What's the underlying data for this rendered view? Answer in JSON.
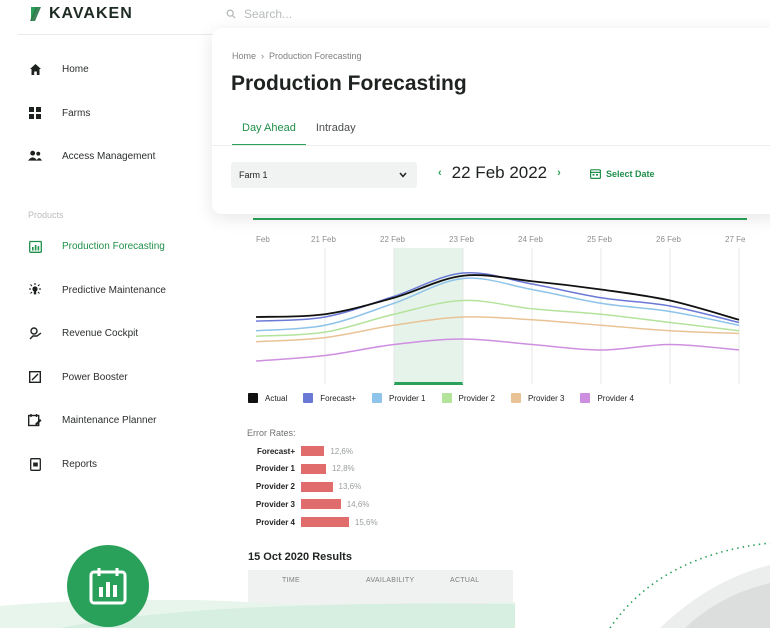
{
  "app": {
    "brand": "KAVAKEN"
  },
  "search": {
    "placeholder": "Search..."
  },
  "sidebar": {
    "items": [
      {
        "label": "Home",
        "icon": "home-icon"
      },
      {
        "label": "Farms",
        "icon": "grid-icon"
      },
      {
        "label": "Access Management",
        "icon": "users-icon"
      }
    ],
    "section_label": "Products",
    "products": [
      {
        "label": "Production Forecasting",
        "icon": "chart-calendar-icon",
        "active": true
      },
      {
        "label": "Predictive Maintenance",
        "icon": "bulb-icon"
      },
      {
        "label": "Revenue Cockpit",
        "icon": "coin-hand-icon"
      },
      {
        "label": "Power Booster",
        "icon": "box-arrow-icon"
      },
      {
        "label": "Maintenance Planner",
        "icon": "calendar-wrench-icon"
      },
      {
        "label": "Reports",
        "icon": "document-icon"
      }
    ]
  },
  "header": {
    "breadcrumb": [
      "Home",
      "Production Forecasting"
    ],
    "title": "Production Forecasting",
    "tabs": [
      {
        "label": "Day Ahead",
        "active": true
      },
      {
        "label": "Intraday",
        "active": false
      }
    ],
    "farm_select": {
      "value": "Farm 1"
    },
    "date": "22 Feb 2022",
    "select_date_label": "Select Date"
  },
  "colors": {
    "accent": "#2aa15a",
    "error_bar": "#e06c6c"
  },
  "chart_data": {
    "type": "line",
    "x": [
      "Feb",
      "21 Feb",
      "22 Feb",
      "23 Feb",
      "24 Feb",
      "25 Feb",
      "26 Feb",
      "27 Fe"
    ],
    "highlight_range": [
      "22 Feb",
      "23 Feb"
    ],
    "legend_placement": "bottom",
    "grid": true,
    "series": [
      {
        "name": "Actual",
        "color": "#111111",
        "values": [
          20,
          22,
          34,
          50,
          46,
          40,
          32,
          18
        ]
      },
      {
        "name": "Forecast+",
        "color": "#6b79d6",
        "values": [
          17,
          20,
          35,
          52,
          44,
          34,
          28,
          16
        ]
      },
      {
        "name": "Provider 1",
        "color": "#8ec3ea",
        "values": [
          10,
          14,
          30,
          48,
          40,
          30,
          24,
          14
        ]
      },
      {
        "name": "Provider 2",
        "color": "#b4e39c",
        "values": [
          6,
          9,
          22,
          32,
          26,
          22,
          16,
          10
        ]
      },
      {
        "name": "Provider 3",
        "color": "#e9c395",
        "values": [
          2,
          5,
          14,
          20,
          18,
          14,
          10,
          8
        ]
      },
      {
        "name": "Provider 4",
        "color": "#cf8fe0",
        "values": [
          -12,
          -8,
          0,
          4,
          0,
          -4,
          0,
          -4
        ]
      }
    ]
  },
  "error_rates": {
    "title": "Error Rates:",
    "rows": [
      {
        "label": "Forecast+",
        "value": 12.6,
        "text": "12,6%"
      },
      {
        "label": "Provider 1",
        "value": 12.8,
        "text": "12,8%"
      },
      {
        "label": "Provider 2",
        "value": 13.6,
        "text": "13,6%"
      },
      {
        "label": "Provider 3",
        "value": 14.6,
        "text": "14,6%"
      },
      {
        "label": "Provider 4",
        "value": 15.6,
        "text": "15,6%"
      }
    ]
  },
  "results": {
    "title": "15 Oct 2020 Results",
    "columns": [
      "TIME",
      "AVAILABILITY",
      "ACTUAL"
    ]
  }
}
